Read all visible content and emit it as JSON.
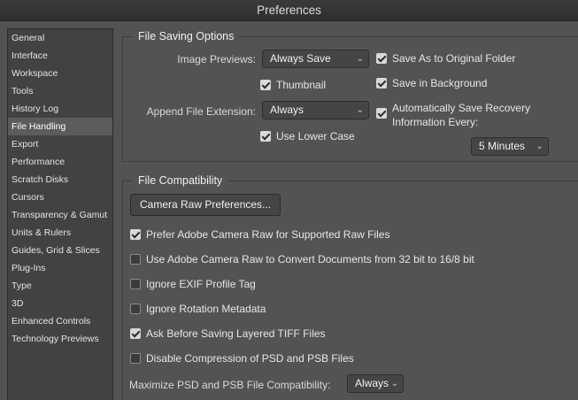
{
  "window": {
    "title": "Preferences"
  },
  "sidebar": {
    "items": [
      {
        "label": "General"
      },
      {
        "label": "Interface"
      },
      {
        "label": "Workspace"
      },
      {
        "label": "Tools"
      },
      {
        "label": "History Log"
      },
      {
        "label": "File Handling",
        "selected": true
      },
      {
        "label": "Export"
      },
      {
        "label": "Performance"
      },
      {
        "label": "Scratch Disks"
      },
      {
        "label": "Cursors"
      },
      {
        "label": "Transparency & Gamut"
      },
      {
        "label": "Units & Rulers"
      },
      {
        "label": "Guides, Grid & Slices"
      },
      {
        "label": "Plug-Ins"
      },
      {
        "label": "Type"
      },
      {
        "label": "3D"
      },
      {
        "label": "Enhanced Controls"
      },
      {
        "label": "Technology Previews"
      }
    ]
  },
  "file_saving": {
    "title": "File Saving Options",
    "image_previews_label": "Image Previews:",
    "image_previews_value": "Always Save",
    "thumbnail_label": "Thumbnail",
    "thumbnail_checked": true,
    "append_ext_label": "Append File Extension:",
    "append_ext_value": "Always",
    "lower_case_label": "Use Lower Case",
    "lower_case_checked": true,
    "save_as_original_label": "Save As to Original Folder",
    "save_as_original_checked": true,
    "save_background_label": "Save in Background",
    "save_background_checked": true,
    "auto_recovery_line1": "Automatically Save Recovery",
    "auto_recovery_line2": "Information Every:",
    "auto_recovery_checked": true,
    "auto_recovery_interval": "5 Minutes"
  },
  "file_compat": {
    "title": "File Compatibility",
    "camera_raw_button": "Camera Raw Preferences...",
    "options": [
      {
        "label": "Prefer Adobe Camera Raw for Supported Raw Files",
        "checked": true
      },
      {
        "label": "Use Adobe Camera Raw to Convert Documents from 32 bit to 16/8 bit",
        "checked": false
      },
      {
        "label": "Ignore EXIF Profile Tag",
        "checked": false
      },
      {
        "label": "Ignore Rotation Metadata",
        "checked": false
      },
      {
        "label": "Ask Before Saving Layered TIFF Files",
        "checked": true
      },
      {
        "label": "Disable Compression of PSD and PSB Files",
        "checked": false
      }
    ],
    "maximize_label": "Maximize PSD and PSB File Compatibility:",
    "maximize_value": "Always"
  }
}
